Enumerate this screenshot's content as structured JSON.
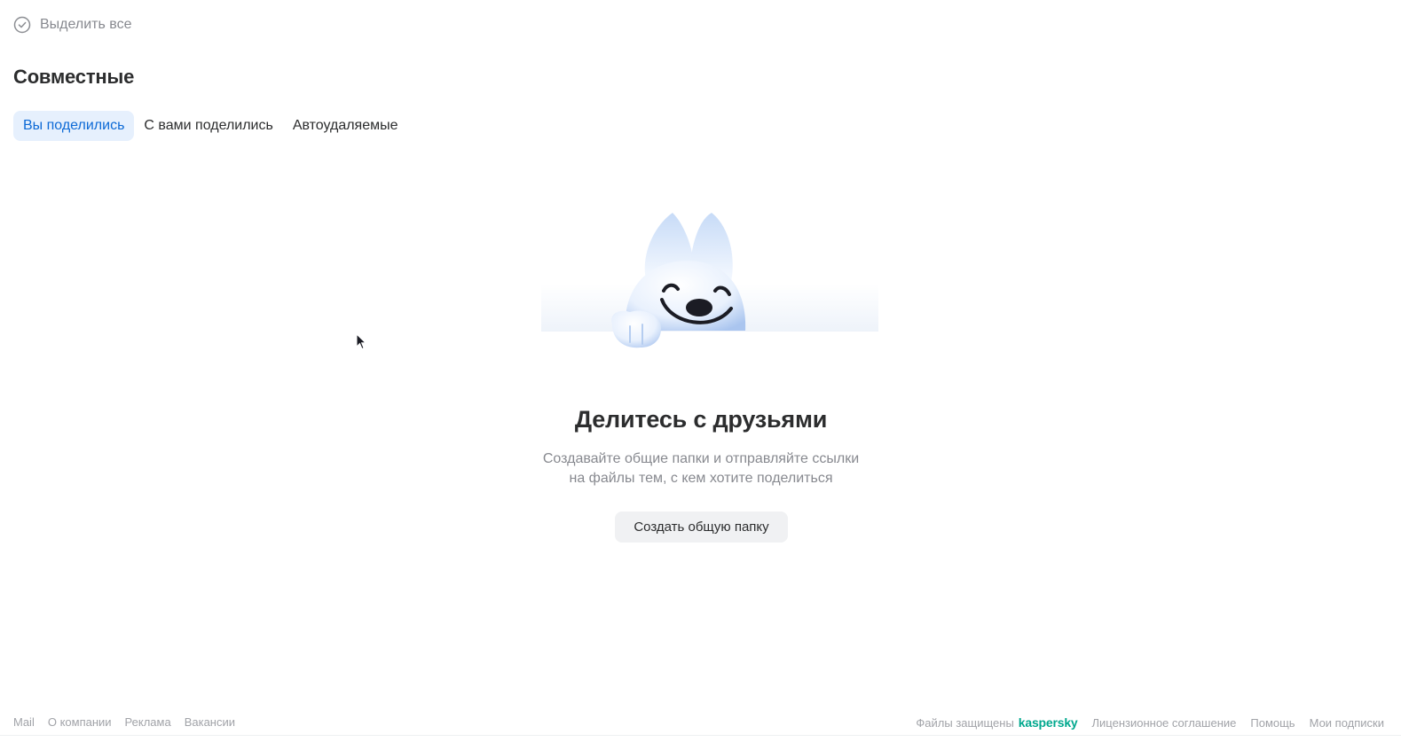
{
  "toolbar": {
    "select_all_label": "Выделить все"
  },
  "section": {
    "title": "Совместные"
  },
  "tabs": [
    {
      "label": "Вы поделились",
      "active": true
    },
    {
      "label": "С вами поделились",
      "active": false
    },
    {
      "label": "Автоудаляемые",
      "active": false
    }
  ],
  "empty_state": {
    "illustration": "smiling-fox-mascot",
    "title": "Делитесь с друзьями",
    "description_line1": "Создавайте общие папки и отправляйте ссылки",
    "description_line2": "на файлы тем, с кем хотите поделиться",
    "button_label": "Создать общую папку"
  },
  "footer": {
    "left_links": [
      "Mail",
      "О компании",
      "Реклама",
      "Вакансии"
    ],
    "protected_text": "Файлы защищены",
    "protected_brand": "kaspersky",
    "right_links": [
      "Лицензионное соглашение",
      "Помощь",
      "Мои подписки"
    ]
  },
  "colors": {
    "accent": "#0d6ad6",
    "active_tab_bg": "#e6f0fd",
    "muted_text": "#87898f",
    "brand_kaspersky": "#00a88e"
  }
}
